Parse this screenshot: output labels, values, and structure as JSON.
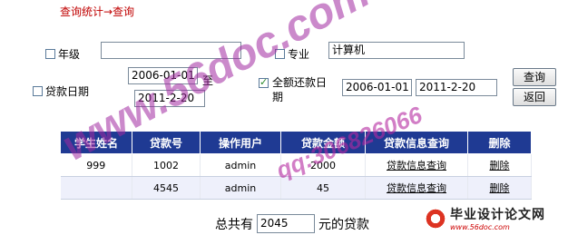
{
  "breadcrumb": "查询统计→查询",
  "filters": {
    "grade_label": "年级",
    "grade_value": "",
    "major_label": "专业",
    "major_value": "计算机",
    "loan_date_label": "贷款日期",
    "loan_date_from": "2006-01-01",
    "loan_date_to_label": "至",
    "loan_date_to": "2011-2-20",
    "repay_date_label": "全额还款日期",
    "repay_date_from": "2006-01-01",
    "repay_date_to": "2011-2-20"
  },
  "buttons": {
    "query": "查询",
    "back": "返回"
  },
  "table": {
    "headers": [
      "学生姓名",
      "贷款号",
      "操作用户",
      "贷款金额",
      "贷款信息查询",
      "删除"
    ],
    "rows": [
      [
        "999",
        "1002",
        "admin",
        "2000",
        "贷款信息查询",
        "删除"
      ],
      [
        "",
        "4545",
        "admin",
        "45",
        "贷款信息查询",
        "删除"
      ]
    ]
  },
  "summary": {
    "prefix": "总共有",
    "value": "2045",
    "suffix": "元的贷款"
  },
  "watermarks": {
    "site": "www.56doc.com",
    "qq": "qq:306826066"
  },
  "logo": {
    "title": "毕业设计论文网",
    "url": "www.56doc.com"
  },
  "colors": {
    "header_bg": "#1f3a93",
    "breadcrumb": "#c00000",
    "alt_row": "#eef0fb"
  }
}
